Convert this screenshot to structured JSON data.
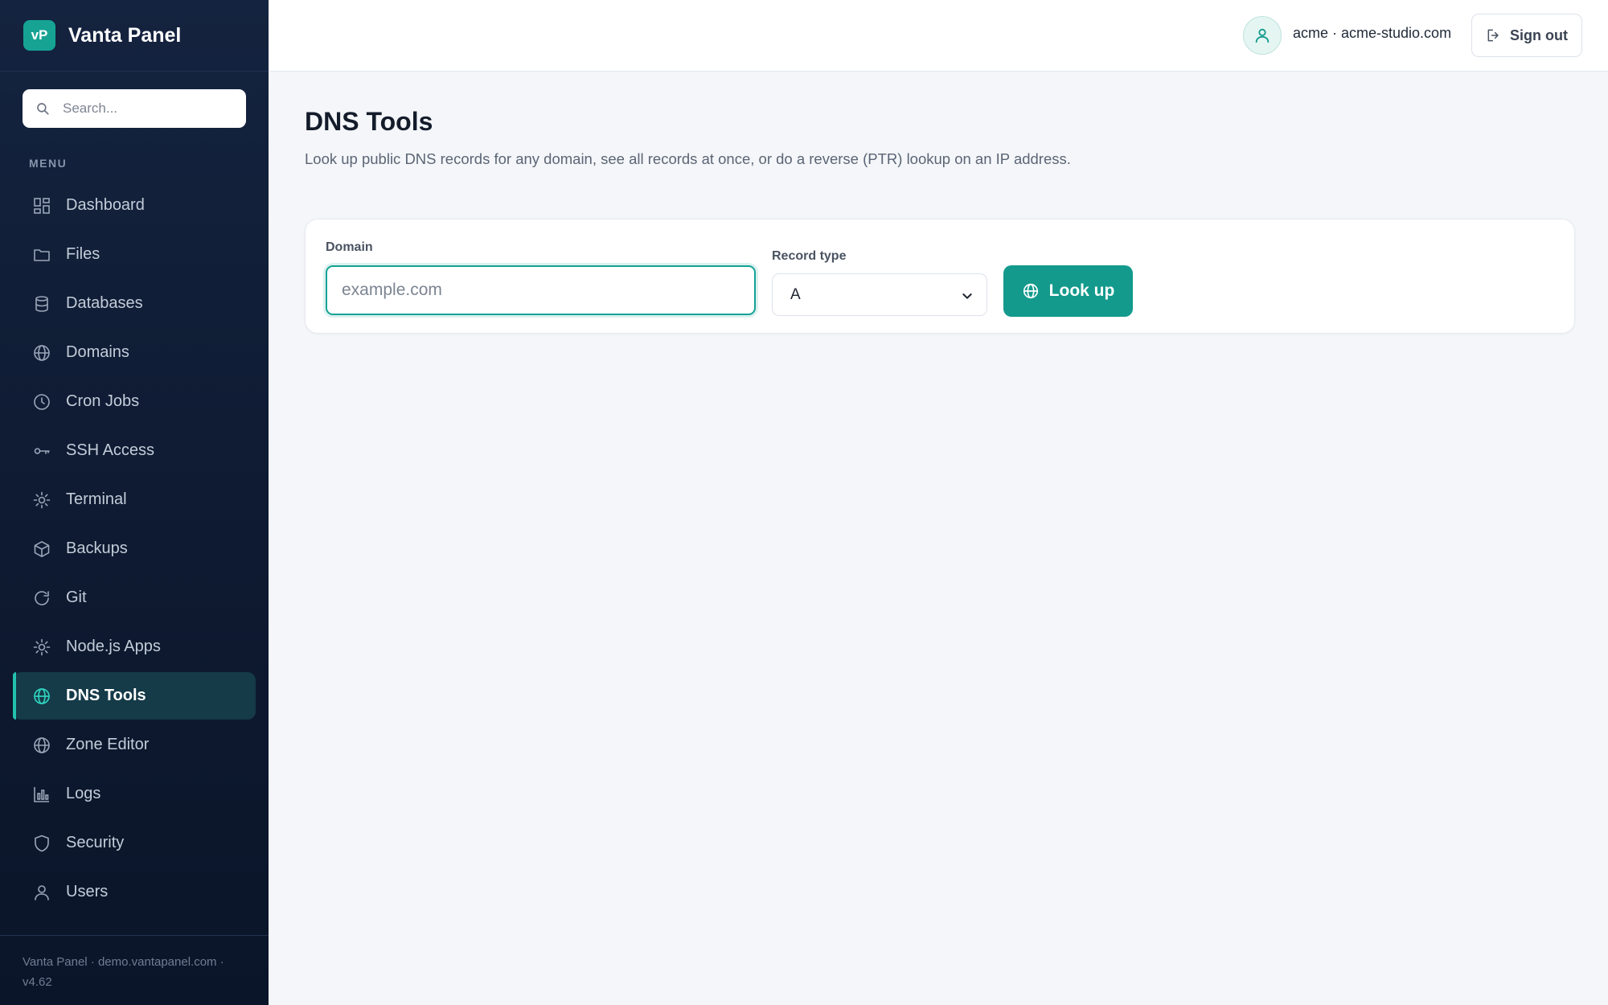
{
  "brand": {
    "logo_text": "vP",
    "name": "Vanta Panel"
  },
  "search": {
    "placeholder": "Search..."
  },
  "sidebar": {
    "menu_label": "MENU",
    "items": [
      {
        "label": "Dashboard",
        "icon": "grid-icon"
      },
      {
        "label": "Files",
        "icon": "folder-icon"
      },
      {
        "label": "Databases",
        "icon": "database-icon"
      },
      {
        "label": "Domains",
        "icon": "globe-icon"
      },
      {
        "label": "Cron Jobs",
        "icon": "clock-icon"
      },
      {
        "label": "SSH Access",
        "icon": "key-icon"
      },
      {
        "label": "Terminal",
        "icon": "sun-icon"
      },
      {
        "label": "Backups",
        "icon": "box-icon"
      },
      {
        "label": "Git",
        "icon": "refresh-icon"
      },
      {
        "label": "Node.js Apps",
        "icon": "sun-icon"
      },
      {
        "label": "DNS Tools",
        "icon": "globe-icon",
        "active": true
      },
      {
        "label": "Zone Editor",
        "icon": "globe-icon"
      },
      {
        "label": "Logs",
        "icon": "bar-chart-icon"
      },
      {
        "label": "Security",
        "icon": "shield-icon"
      },
      {
        "label": "Users",
        "icon": "user-icon"
      }
    ],
    "footer": "Vanta Panel · demo.vantapanel.com · v4.62"
  },
  "topbar": {
    "account": "acme · acme-studio.com",
    "sign_out": "Sign out"
  },
  "main": {
    "title": "DNS Tools",
    "description": "Look up public DNS records for any domain, see all records at once, or do a reverse (PTR) lookup on an IP address.",
    "form": {
      "domain_label": "Domain",
      "domain_placeholder": "example.com",
      "domain_value": "",
      "record_type_label": "Record type",
      "record_type_value": "A",
      "lookup_label": "Look up"
    }
  },
  "colors": {
    "accent": "#139a8c",
    "sidebar_bg": "#0e1a31",
    "active_item_bg": "#153a48",
    "page_bg": "#f4f6f9"
  }
}
